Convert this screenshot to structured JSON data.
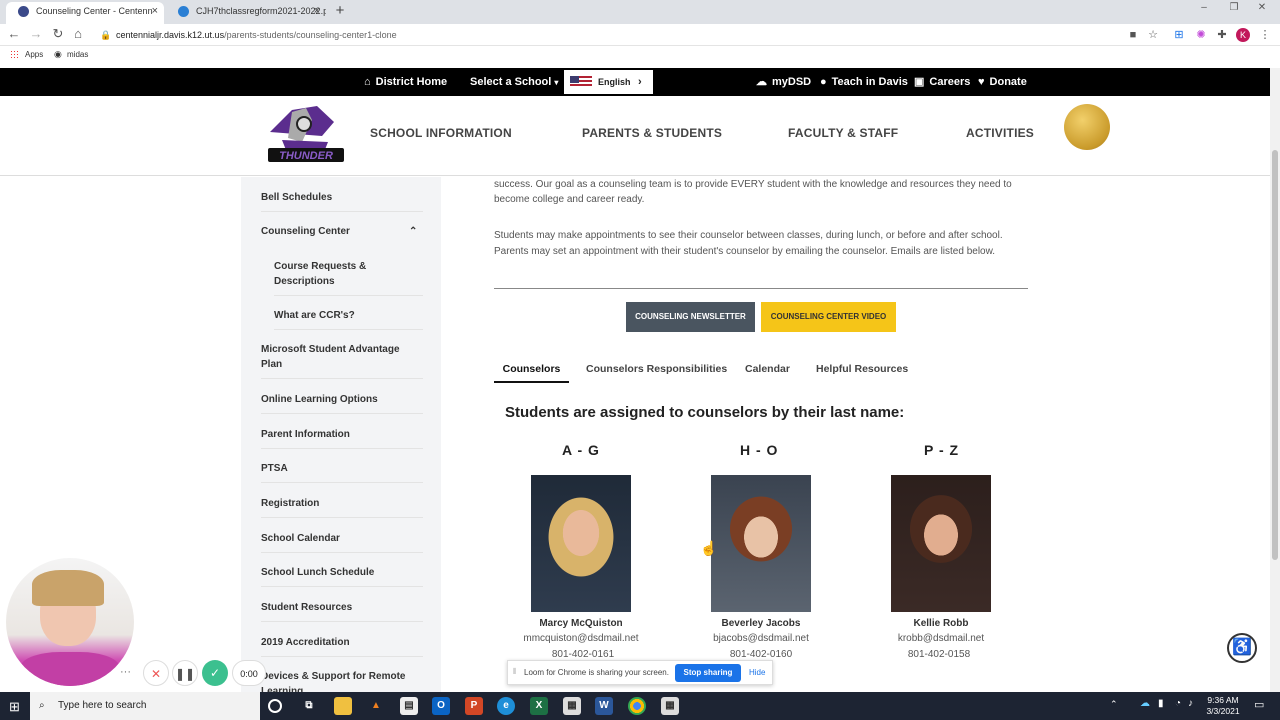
{
  "browser": {
    "tabs": [
      {
        "title": "Counseling Center - Centenn",
        "active": true
      },
      {
        "title": "CJH7thclassregform2021-2022.p",
        "active": false
      }
    ],
    "url_host": "centennialjr.davis.k12.ut.us",
    "url_path": "/parents-students/counseling-center1-clone",
    "bookmarks": [
      "Apps",
      "midas"
    ],
    "profile_initial": "K"
  },
  "topbar": {
    "district_home": "District Home",
    "select_school": "Select a School",
    "language": "English",
    "mydsd": "myDSD",
    "teach": "Teach in Davis",
    "careers": "Careers",
    "donate": "Donate"
  },
  "header": {
    "logo_text": "THUNDER",
    "nav": [
      "SCHOOL INFORMATION",
      "PARENTS & STUDENTS",
      "FACULTY & STAFF",
      "ACTIVITIES"
    ]
  },
  "sidebar": {
    "items": [
      {
        "label": "Bell Schedules"
      },
      {
        "label": "Counseling Center",
        "expanded": true
      },
      {
        "label": "Course Requests & Descriptions",
        "sub": true
      },
      {
        "label": "What are CCR's?",
        "sub": true
      },
      {
        "label": "Microsoft Student Advantage Plan"
      },
      {
        "label": "Online Learning Options"
      },
      {
        "label": "Parent Information"
      },
      {
        "label": "PTSA"
      },
      {
        "label": "Registration"
      },
      {
        "label": "School Calendar"
      },
      {
        "label": "School Lunch Schedule"
      },
      {
        "label": "Student Resources"
      },
      {
        "label": "2019 Accreditation"
      },
      {
        "label": "Devices & Support for Remote Learning"
      }
    ]
  },
  "content": {
    "intro_partial": "Centennial Jr. High's Counseling Department is a comprehensive counseling program that is dedicated to student success.  Our goal as a counseling team is to provide EVERY student with the knowledge and resources they need to become college and career ready.",
    "appointments": "Students may make appointments to see their counselor between classes, during lunch, or before and after school. Parents may set an appointment with their student's counselor by emailing the counselor.  Emails are listed below.",
    "newsletter_btn": "COUNSELING NEWSLETTER",
    "video_btn": "COUNSELING CENTER VIDEO",
    "tabs": [
      "Counselors",
      "Counselors Responsibilities",
      "Calendar",
      "Helpful Resources"
    ],
    "assign_heading": "Students are assigned to counselors by their last name:",
    "counselors": [
      {
        "range": "A - G",
        "name": "Marcy McQuiston",
        "email": "mmcquiston@dsdmail.net",
        "phone": "801-402-0161"
      },
      {
        "range": "H - O",
        "name": "Beverley Jacobs",
        "email": "bjacobs@dsdmail.net",
        "phone": "801-402-0160"
      },
      {
        "range": "P - Z",
        "name": "Kellie Robb",
        "email": "krobb@dsdmail.net",
        "phone": "801-402-0158"
      }
    ]
  },
  "loom": {
    "timer": "0:00",
    "share_text": "Loom for Chrome is sharing your screen.",
    "stop_label": "Stop sharing",
    "hide_label": "Hide"
  },
  "taskbar": {
    "search_placeholder": "Type here to search",
    "time": "9:36 AM",
    "date": "3/3/2021"
  },
  "colors": {
    "topbar": "#000000",
    "newsletter_btn": "#4a5560",
    "video_btn": "#f5c518",
    "stop_btn": "#1a73e8",
    "taskbar": "#1d2433"
  }
}
